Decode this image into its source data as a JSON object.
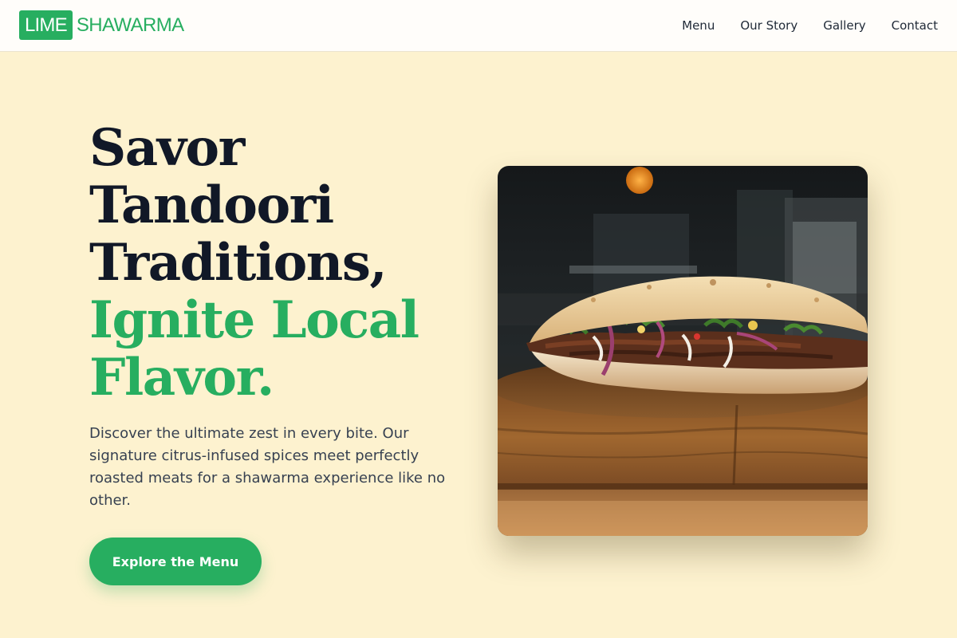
{
  "brand": {
    "badge": "LIME",
    "word": "SHAWARMA"
  },
  "nav": {
    "items": [
      {
        "label": "Menu"
      },
      {
        "label": "Our Story"
      },
      {
        "label": "Gallery"
      },
      {
        "label": "Contact"
      }
    ]
  },
  "hero": {
    "headline_lines": [
      "Savor",
      "Tandoori",
      "Traditions,"
    ],
    "accent_lines": [
      "Ignite Local",
      "Flavor."
    ],
    "description": "Discover the ultimate zest in every bite. Our signature citrus-infused spices meet perfectly roasted meats for a shawarma experience like no other.",
    "cta_label": "Explore the Menu"
  },
  "colors": {
    "brand_green": "#27ae60",
    "background": "#fdf2cf",
    "heading": "#111827"
  }
}
